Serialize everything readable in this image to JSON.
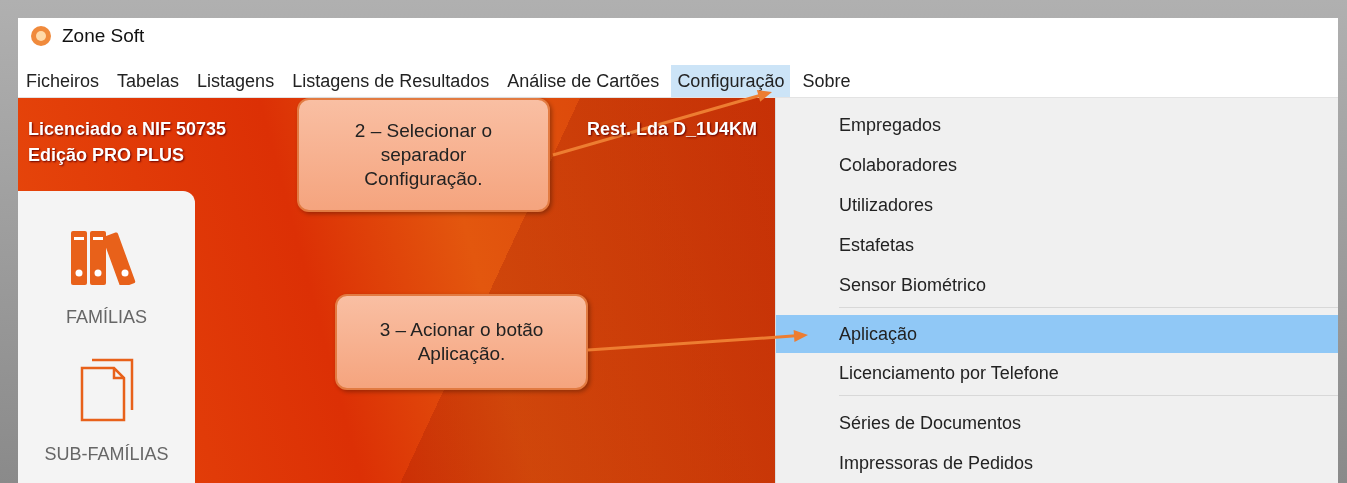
{
  "window": {
    "title": "Zone Soft"
  },
  "menubar": [
    {
      "label": "Ficheiros",
      "selected": false
    },
    {
      "label": "Tabelas",
      "selected": false
    },
    {
      "label": "Listagens",
      "selected": false
    },
    {
      "label": "Listagens de Resultados",
      "selected": false
    },
    {
      "label": "Análise de Cartões",
      "selected": false
    },
    {
      "label": "Configuração",
      "selected": true
    },
    {
      "label": "Sobre",
      "selected": false
    }
  ],
  "license": {
    "line_1_start": "Licenciado a NIF 50735",
    "line_1_end": "Rest. Lda D_1U4KM",
    "line_2": "Edição PRO PLUS"
  },
  "sidebar": {
    "items": [
      {
        "label": "FAMÍLIAS",
        "kind": "binders"
      },
      {
        "label": "SUB-FAMÍLIAS",
        "kind": "pages"
      }
    ]
  },
  "dropdown": {
    "groups": [
      {
        "items": [
          {
            "label": "Empregados",
            "selected": false
          },
          {
            "label": "Colaboradores",
            "selected": false
          },
          {
            "label": "Utilizadores",
            "selected": false
          },
          {
            "label": "Estafetas",
            "selected": false
          },
          {
            "label": "Sensor Biométrico",
            "selected": false
          }
        ]
      },
      {
        "items": [
          {
            "label": "Aplicação",
            "selected": true
          },
          {
            "label": "Licenciamento por Telefone",
            "selected": false
          }
        ]
      },
      {
        "items": [
          {
            "label": "Séries de Documentos",
            "selected": false
          },
          {
            "label": "Impressoras de Pedidos",
            "selected": false
          }
        ]
      }
    ]
  },
  "callouts": [
    {
      "text": "2 – Selecionar o separador Configuração."
    },
    {
      "text": "3 – Acionar o botão Aplicação."
    }
  ]
}
